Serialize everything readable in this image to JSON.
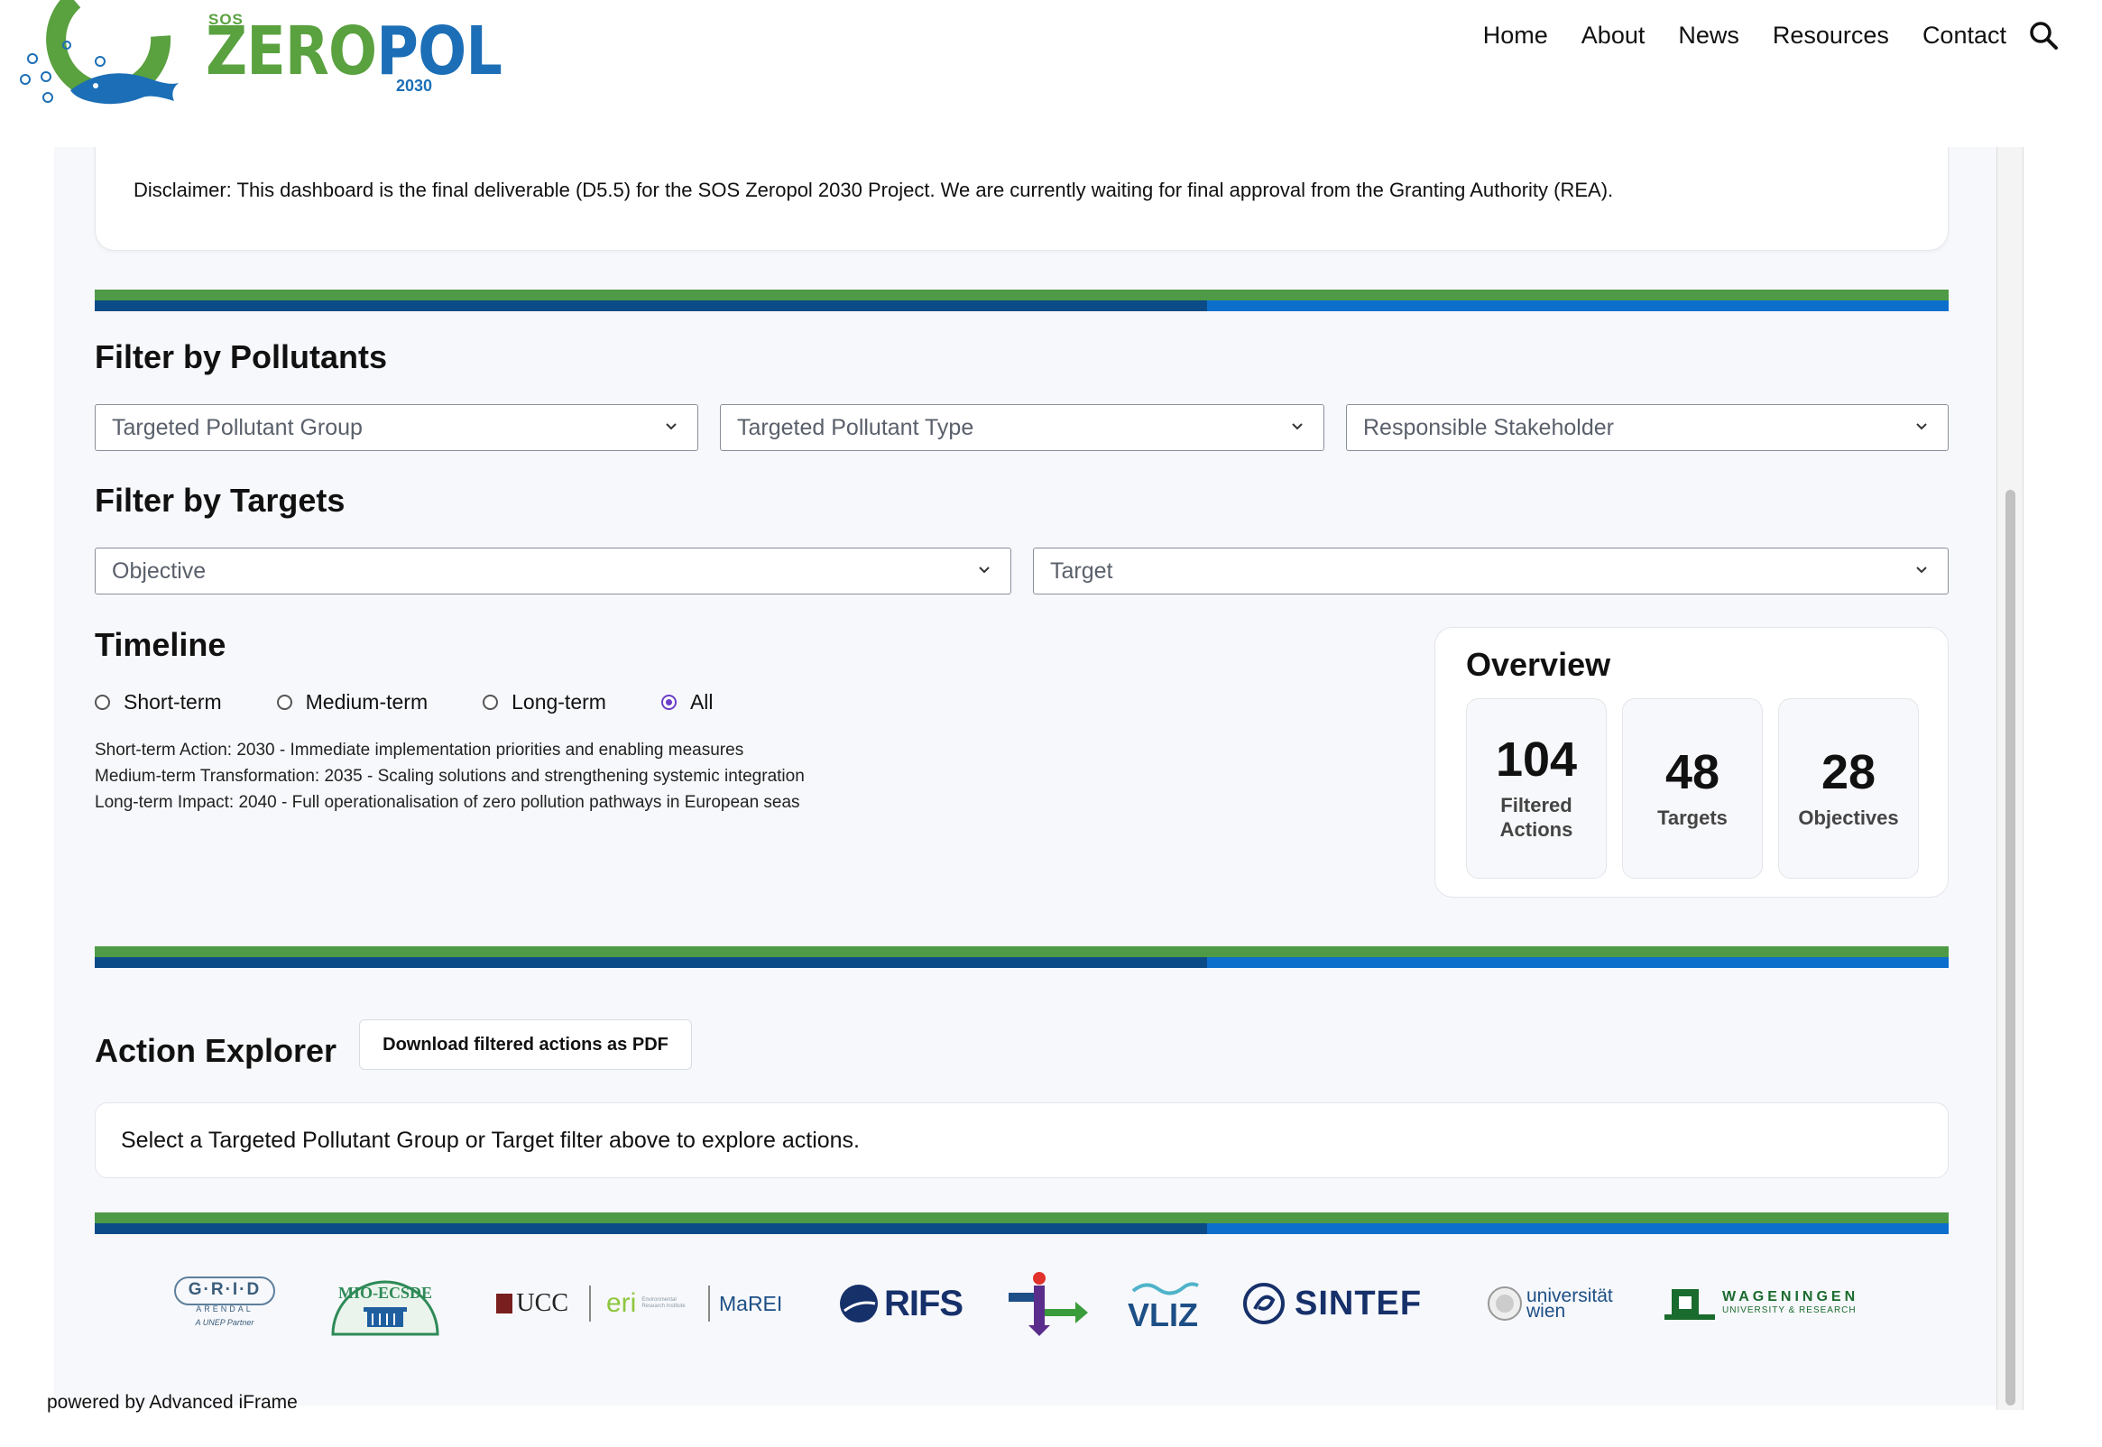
{
  "logo": {
    "sos": "SOS",
    "word_left": "ZERO",
    "word_right": "POL",
    "year": "2030"
  },
  "nav": {
    "items": [
      "Home",
      "About",
      "News",
      "Resources",
      "Contact"
    ]
  },
  "disclaimer": "Disclaimer: This dashboard is the final deliverable (D5.5) for the SOS Zeropol 2030 Project. We are currently waiting for final approval from the Granting Authority (REA).",
  "filters_pollutants": {
    "title": "Filter by Pollutants",
    "group_placeholder": "Targeted Pollutant Group",
    "type_placeholder": "Targeted Pollutant Type",
    "stakeholder_placeholder": "Responsible Stakeholder"
  },
  "filters_targets": {
    "title": "Filter by Targets",
    "objective_placeholder": "Objective",
    "target_placeholder": "Target"
  },
  "timeline": {
    "title": "Timeline",
    "options": [
      "Short-term",
      "Medium-term",
      "Long-term",
      "All"
    ],
    "selected": "All",
    "lines": [
      "Short-term Action: 2030 - Immediate implementation priorities and enabling measures",
      "Medium-term Transformation: 2035 - Scaling solutions and strengthening systemic integration",
      "Long-term Impact: 2040 - Full operationalisation of zero pollution pathways in European seas"
    ]
  },
  "overview": {
    "title": "Overview",
    "stats": [
      {
        "value": "104",
        "label": "Filtered Actions"
      },
      {
        "value": "48",
        "label": "Targets"
      },
      {
        "value": "28",
        "label": "Objectives"
      }
    ]
  },
  "explorer": {
    "title": "Action Explorer",
    "download_label": "Download filtered actions as PDF",
    "empty_message": "Select a Targeted Pollutant Group or Target filter above to explore actions."
  },
  "partners": {
    "grid": "G·R·I·D",
    "grid_sub": "ARENDAL",
    "grid_tag": "A UNEP Partner",
    "mio": "MIO-ECSDE",
    "ucc": "UCC",
    "eri": "eri",
    "eri_sub": "Environmental Research Institute",
    "marei": "MaREI",
    "rifs": "RIFS",
    "vliz": "VLIZ",
    "sintef": "SINTEF",
    "univie_1": "universität",
    "univie_2": "wien",
    "wur_1": "WAGENINGEN",
    "wur_2": "UNIVERSITY & RESEARCH"
  },
  "footer": {
    "powered": "powered by Advanced iFrame"
  },
  "colors": {
    "green": "#4e9a46",
    "navy": "#0b4b87",
    "blue": "#0c6fcc",
    "radio_accent": "#6c3fc8"
  }
}
